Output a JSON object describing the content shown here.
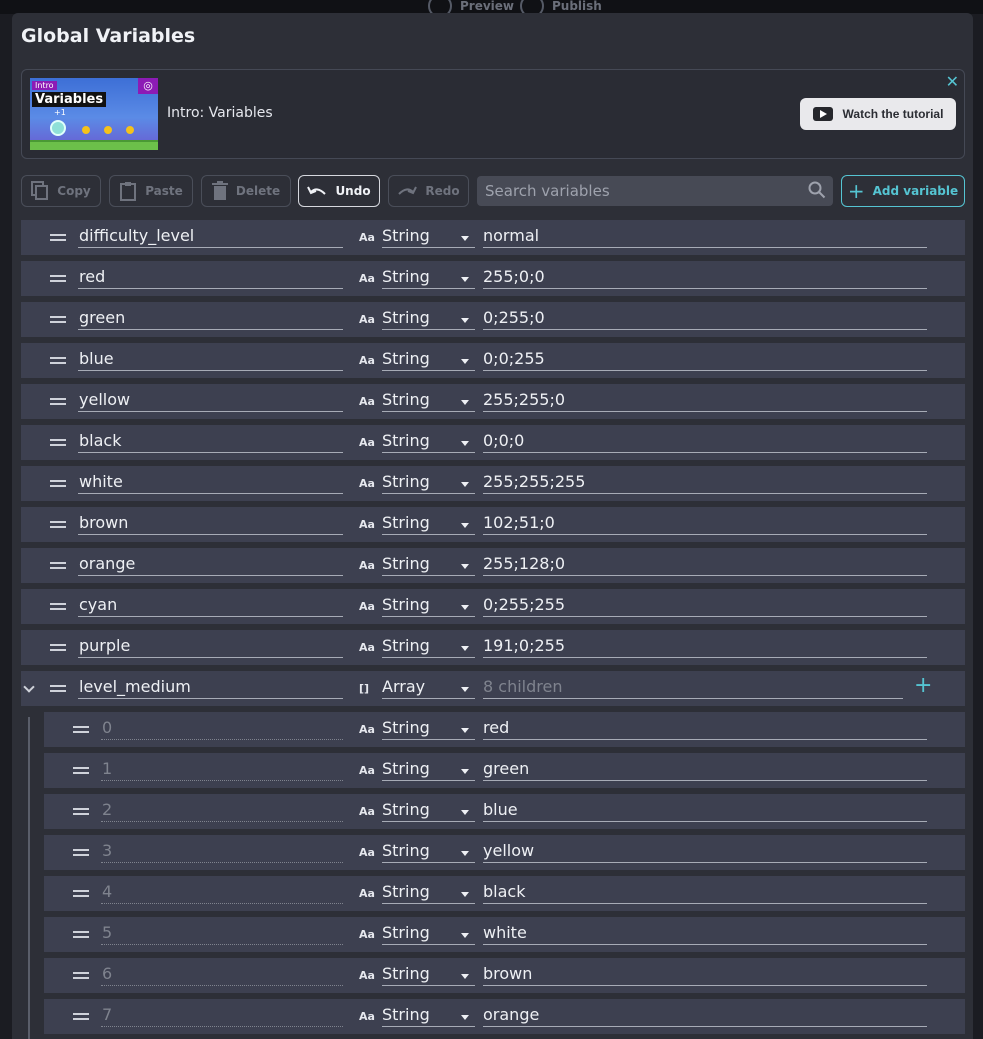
{
  "topbar": {
    "preview": "Preview",
    "publish": "Publish"
  },
  "dialog": {
    "title": "Global Variables"
  },
  "tutorial": {
    "thumb_small": "Intro",
    "thumb_big": "Variables",
    "thumb_plus": "+1",
    "label": "Intro: Variables",
    "watch_label": "Watch the tutorial",
    "close": "✕"
  },
  "toolbar": {
    "copy": "Copy",
    "paste": "Paste",
    "delete": "Delete",
    "undo": "Undo",
    "redo": "Redo",
    "search_placeholder": "Search variables",
    "add": "Add variable"
  },
  "type_icons": {
    "string": "Aa",
    "array": "[]"
  },
  "variables": [
    {
      "name": "difficulty_level",
      "type": "String",
      "value": "normal"
    },
    {
      "name": "red",
      "type": "String",
      "value": "255;0;0"
    },
    {
      "name": "green",
      "type": "String",
      "value": "0;255;0"
    },
    {
      "name": "blue",
      "type": "String",
      "value": "0;0;255"
    },
    {
      "name": "yellow",
      "type": "String",
      "value": "255;255;0"
    },
    {
      "name": "black",
      "type": "String",
      "value": "0;0;0"
    },
    {
      "name": "white",
      "type": "String",
      "value": "255;255;255"
    },
    {
      "name": "brown",
      "type": "String",
      "value": "102;51;0"
    },
    {
      "name": "orange",
      "type": "String",
      "value": "255;128;0"
    },
    {
      "name": "cyan",
      "type": "String",
      "value": "0;255;255"
    },
    {
      "name": "purple",
      "type": "String",
      "value": "191;0;255"
    },
    {
      "name": "level_medium",
      "type": "Array",
      "value": "8 children"
    }
  ],
  "children": [
    {
      "name": "0",
      "type": "String",
      "value": "red"
    },
    {
      "name": "1",
      "type": "String",
      "value": "green"
    },
    {
      "name": "2",
      "type": "String",
      "value": "blue"
    },
    {
      "name": "3",
      "type": "String",
      "value": "yellow"
    },
    {
      "name": "4",
      "type": "String",
      "value": "black"
    },
    {
      "name": "5",
      "type": "String",
      "value": "white"
    },
    {
      "name": "6",
      "type": "String",
      "value": "brown"
    },
    {
      "name": "7",
      "type": "String",
      "value": "orange"
    }
  ],
  "colors": {
    "accent": "#55c4d2",
    "row_bg": "#3d4050",
    "dialog_bg": "#2d2f37"
  }
}
